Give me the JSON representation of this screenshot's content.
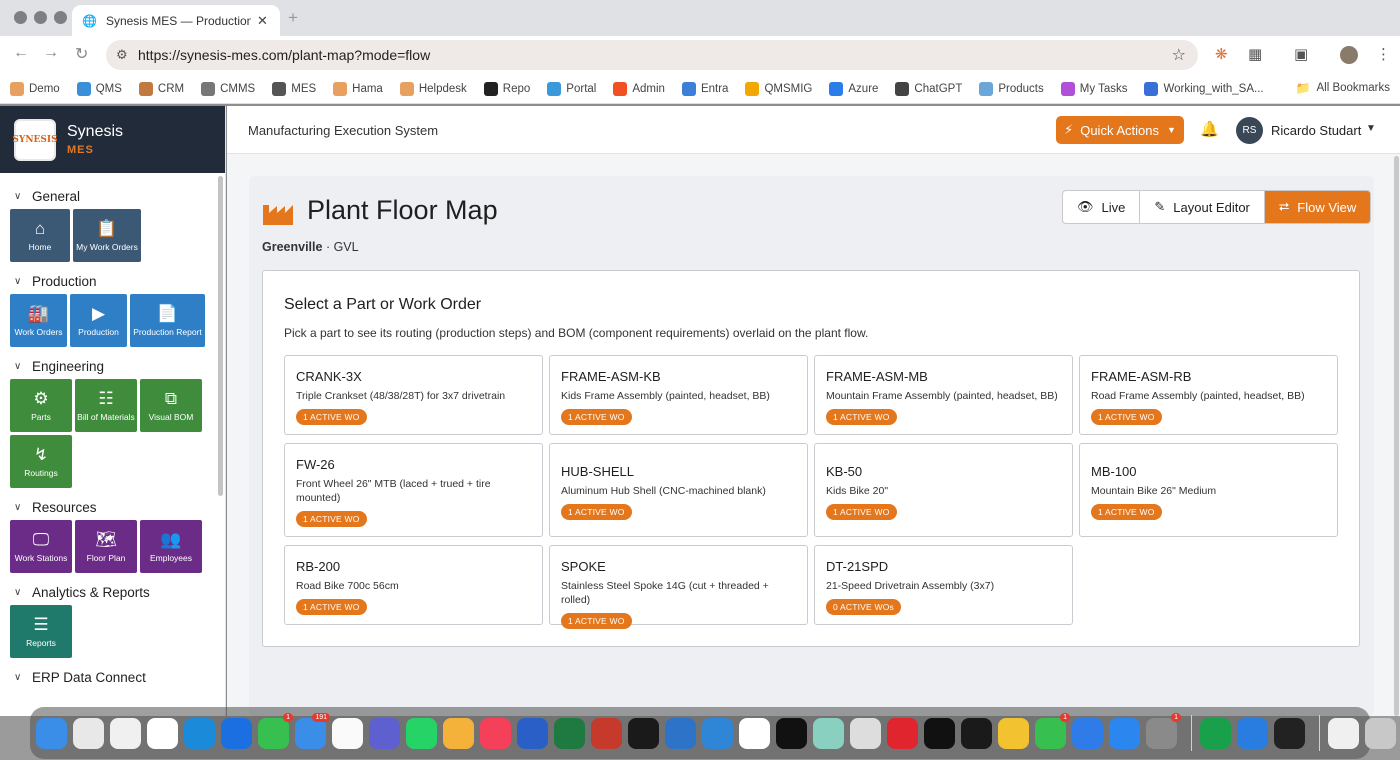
{
  "browser": {
    "tab_title": "Synesis MES — Production Tr",
    "url": "https://synesis-mes.com/plant-map?mode=flow",
    "bookmarks": [
      "Demo",
      "QMS",
      "CRM",
      "CMMS",
      "MES",
      "Hama",
      "Helpdesk",
      "Repo",
      "Portal",
      "Admin",
      "Entra",
      "QMSMIG",
      "Azure",
      "ChatGPT",
      "Products",
      "My Tasks",
      "Working_with_SA..."
    ],
    "all_bookmarks": "All Bookmarks"
  },
  "brand": {
    "name": "Synesis",
    "sub": "MES",
    "logo_text": "SYNESIS"
  },
  "sidebar": {
    "sections": [
      {
        "title": "General",
        "tiles": [
          {
            "label": "Home",
            "icon": "home-icon"
          },
          {
            "label": "My Work Orders",
            "icon": "clipboard-icon"
          }
        ]
      },
      {
        "title": "Production",
        "tiles": [
          {
            "label": "Work Orders",
            "icon": "factory-icon"
          },
          {
            "label": "Production",
            "icon": "play-icon"
          },
          {
            "label": "Production Report",
            "icon": "document-icon"
          }
        ]
      },
      {
        "title": "Engineering",
        "tiles": [
          {
            "label": "Parts",
            "icon": "gears-icon"
          },
          {
            "label": "Bill of Materials",
            "icon": "hierarchy-icon"
          },
          {
            "label": "Visual BOM",
            "icon": "diagram-icon"
          },
          {
            "label": "Routings",
            "icon": "route-icon"
          }
        ]
      },
      {
        "title": "Resources",
        "tiles": [
          {
            "label": "Work Stations",
            "icon": "monitor-icon"
          },
          {
            "label": "Floor Plan",
            "icon": "map-icon"
          },
          {
            "label": "Employees",
            "icon": "people-icon"
          }
        ]
      },
      {
        "title": "Analytics & Reports",
        "tiles": [
          {
            "label": "Reports",
            "icon": "list-icon"
          }
        ]
      },
      {
        "title": "ERP Data Connect",
        "tiles": []
      }
    ]
  },
  "header": {
    "app_title": "Manufacturing Execution System",
    "quick_actions": "Quick Actions",
    "user_initials": "RS",
    "user_name": "Ricardo Studart"
  },
  "page": {
    "title": "Plant Floor Map",
    "site_name": "Greenville",
    "site_code": "· GVL",
    "views": [
      {
        "label": "Live",
        "icon": "eye-icon",
        "active": false
      },
      {
        "label": "Layout Editor",
        "icon": "edit-icon",
        "active": false
      },
      {
        "label": "Flow View",
        "icon": "flow-icon",
        "active": true
      }
    ],
    "selector_title": "Select a Part or Work Order",
    "selector_desc": "Pick a part to see its routing (production steps) and BOM (component requirements) overlaid on the plant flow."
  },
  "parts": [
    {
      "code": "CRANK-3X",
      "desc": "Triple Crankset (48/38/28T) for 3x7 drivetrain",
      "badge": "1 ACTIVE WO"
    },
    {
      "code": "FRAME-ASM-KB",
      "desc": "Kids Frame Assembly (painted, headset, BB)",
      "badge": "1 ACTIVE WO"
    },
    {
      "code": "FRAME-ASM-MB",
      "desc": "Mountain Frame Assembly (painted, headset, BB)",
      "badge": "1 ACTIVE WO"
    },
    {
      "code": "FRAME-ASM-RB",
      "desc": "Road Frame Assembly (painted, headset, BB)",
      "badge": "1 ACTIVE WO"
    },
    {
      "code": "FW-26",
      "desc": "Front Wheel 26\" MTB (laced + trued + tire mounted)",
      "badge": "1 ACTIVE WO"
    },
    {
      "code": "HUB-SHELL",
      "desc": "Aluminum Hub Shell (CNC-machined blank)",
      "badge": "1 ACTIVE WO"
    },
    {
      "code": "KB-50",
      "desc": "Kids Bike 20\"",
      "badge": "1 ACTIVE WO"
    },
    {
      "code": "MB-100",
      "desc": "Mountain Bike 26\" Medium",
      "badge": "1 ACTIVE WO"
    },
    {
      "code": "RB-200",
      "desc": "Road Bike 700c 56cm",
      "badge": "1 ACTIVE WO"
    },
    {
      "code": "SPOKE",
      "desc": "Stainless Steel Spoke 14G (cut + threaded + rolled)",
      "badge": "1 ACTIVE WO"
    },
    {
      "code": "DT-21SPD",
      "desc": "21-Speed Drivetrain Assembly (3x7)",
      "badge": "0 ACTIVE WOs"
    }
  ],
  "dock": {
    "badges": [
      "1",
      "191",
      "1",
      "1"
    ]
  },
  "colors": {
    "accent": "#e4761c",
    "brand_dark": "#212b3a",
    "general": "#3b5875",
    "production": "#2f7fc7",
    "engineering": "#3f8d3c",
    "resources": "#6a2c86",
    "analytics": "#1f7a6c"
  }
}
